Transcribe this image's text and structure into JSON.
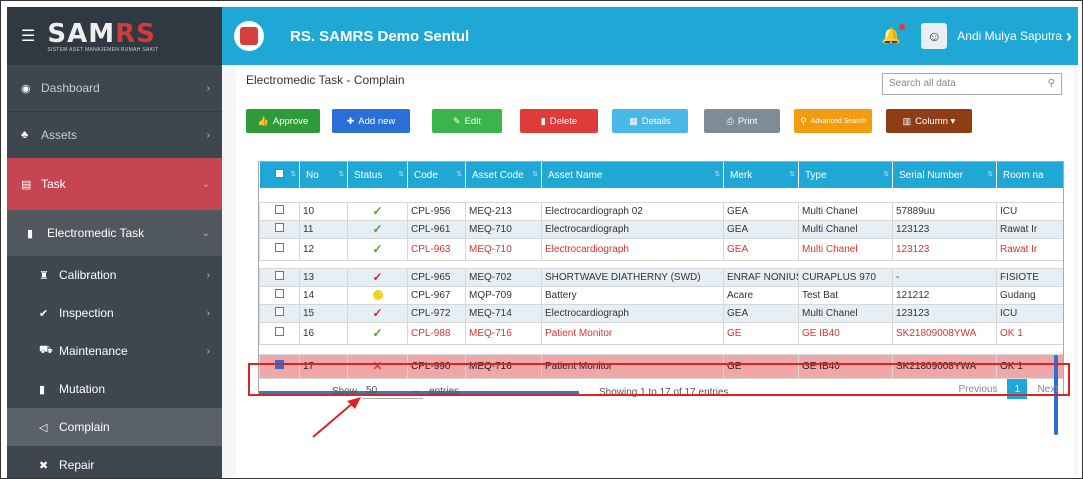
{
  "logo": {
    "text_a": "SAM",
    "text_b": "RS",
    "subtitle": "SISTEM ASET MANAJEMEN RUMAH SAKIT"
  },
  "sidebar": {
    "items": [
      {
        "label": "Dashboard",
        "icon": "dashboard-icon"
      },
      {
        "label": "Assets",
        "icon": "assets-icon"
      },
      {
        "label": "Task",
        "icon": "task-icon"
      },
      {
        "label": "Electromedic Task",
        "icon": "file-icon"
      },
      {
        "label": "Calibration",
        "icon": "calibration-icon"
      },
      {
        "label": "Inspection",
        "icon": "check-icon"
      },
      {
        "label": "Maintenance",
        "icon": "maintenance-icon"
      },
      {
        "label": "Mutation",
        "icon": "mutation-icon"
      },
      {
        "label": "Complain",
        "icon": "megaphone-icon"
      },
      {
        "label": "Repair",
        "icon": "repair-icon"
      }
    ]
  },
  "header": {
    "title": "RS. SAMRS Demo Sentul",
    "user_name": "Andi Mulya Saputra"
  },
  "main": {
    "page_title": "Electromedic Task - Complain",
    "search_placeholder": "Search all data",
    "buttons": {
      "approve": "Approve",
      "add": "Add new",
      "edit": "Edit",
      "delete": "Delete",
      "details": "Details",
      "print": "Print",
      "advanced": "Advanced Search",
      "column": "Column"
    },
    "colors": {
      "approve": "#2f9a3a",
      "add": "#2a6fd6",
      "edit": "#3bb54a",
      "delete": "#e03b3b",
      "details": "#49b8e6",
      "print": "#7d8c96",
      "advanced": "#f39c12",
      "column": "#8f3d14"
    },
    "table": {
      "headers": [
        "No",
        "Status",
        "Code",
        "Asset Code",
        "Asset Name",
        "Merk",
        "Type",
        "Serial Number",
        "Room na"
      ],
      "rows": [
        {
          "no": "10",
          "status": "ok",
          "code": "CPL-956",
          "asset_code": "MEQ-213",
          "name": "Electrocardiograph 02",
          "merk": "GEA",
          "type": "Multi Chanel",
          "serial": "57889uu",
          "room": "ICU"
        },
        {
          "no": "11",
          "status": "ok",
          "code": "CPL-961",
          "asset_code": "MEQ-710",
          "name": "Electrocardiograph",
          "merk": "GEA",
          "type": "Multi Chanel",
          "serial": "123123",
          "room": "Rawat Ir"
        },
        {
          "no": "12",
          "status": "ok",
          "code": "CPL-963",
          "asset_code": "MEQ-710",
          "name": "Electrocardiograph",
          "merk": "GEA",
          "type": "Multi Chanel",
          "serial": "123123",
          "room": "Rawat Ir"
        },
        {
          "no": "13",
          "status": "bad",
          "code": "CPL-965",
          "asset_code": "MEQ-702",
          "name": "SHORTWAVE DIATHERNY (SWD)",
          "merk": "ENRAF NONIUS",
          "type": "CURAPLUS 970",
          "serial": "-",
          "room": "FISIOTE"
        },
        {
          "no": "14",
          "status": "pending",
          "code": "CPL-967",
          "asset_code": "MQP-709",
          "name": "Battery",
          "merk": "Acare",
          "type": "Test Bat",
          "serial": "121212",
          "room": "Gudang"
        },
        {
          "no": "15",
          "status": "bad",
          "code": "CPL-972",
          "asset_code": "MEQ-714",
          "name": "Electrocardiograph",
          "merk": "GEA",
          "type": "Multi Chanel",
          "serial": "123123",
          "room": "ICU"
        },
        {
          "no": "16",
          "status": "ok",
          "code": "CPL-988",
          "asset_code": "MEQ-716",
          "name": "Patient Monitor",
          "merk": "GE",
          "type": "GE IB40",
          "serial": "SK21809008YWA",
          "room": "OK 1"
        },
        {
          "no": "17",
          "status": "rejected",
          "code": "CPL-990",
          "asset_code": "MEQ-716",
          "name": "Patient Monitor",
          "merk": "GE",
          "type": "GE IB40",
          "serial": "SK21809008YWA",
          "room": "OK 1"
        }
      ]
    },
    "footer": {
      "show_label": "Show",
      "page_size": "50",
      "entries_label": "entries",
      "info": "Showing 1 to 17 of 17 entries",
      "previous": "Previous",
      "page": "1",
      "next": "Next"
    }
  }
}
